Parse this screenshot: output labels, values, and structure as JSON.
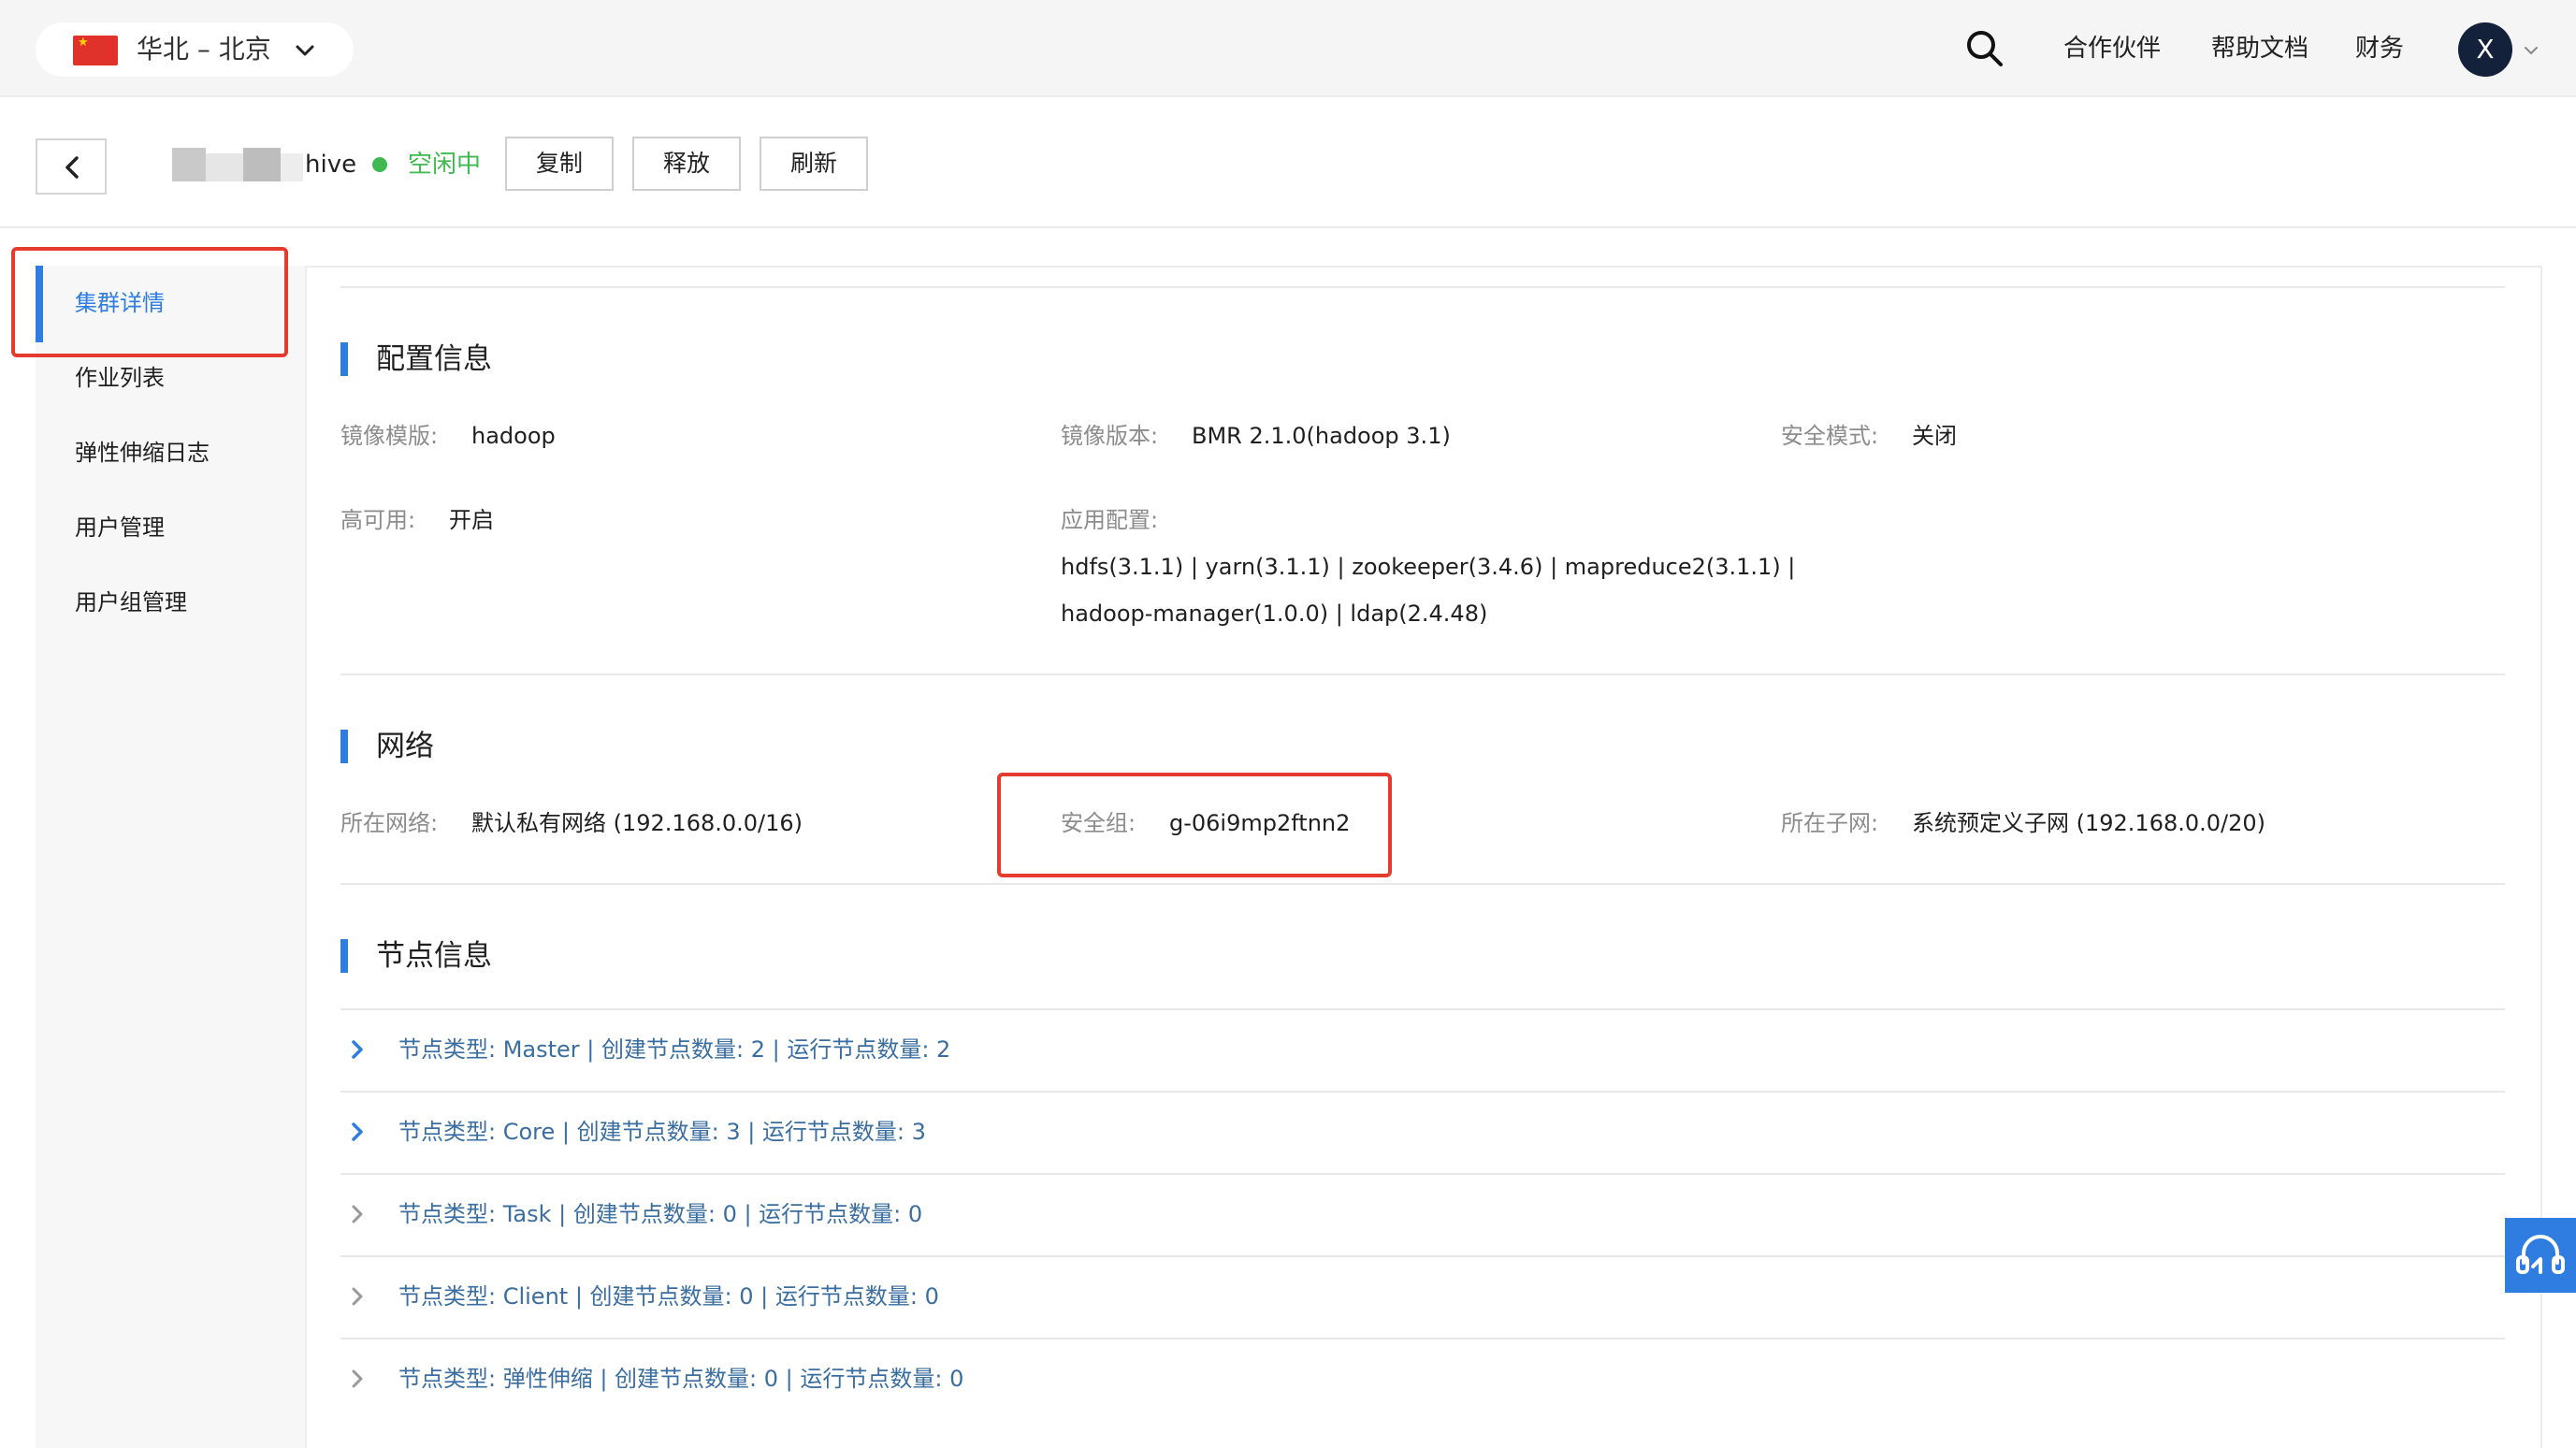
{
  "header": {
    "region_label": "华北 – 北京",
    "nav": {
      "partners": "合作伙伴",
      "docs": "帮助文档",
      "finance": "财务"
    },
    "avatar_initial": "X"
  },
  "titlebar": {
    "cluster_name": "hive",
    "status": "空闲中",
    "buttons": {
      "copy": "复制",
      "release": "释放",
      "refresh": "刷新"
    }
  },
  "sidebar": {
    "items": [
      {
        "label": "集群详情",
        "active": true
      },
      {
        "label": "作业列表"
      },
      {
        "label": "弹性伸缩日志"
      },
      {
        "label": "用户管理"
      },
      {
        "label": "用户组管理"
      }
    ]
  },
  "config": {
    "title": "配置信息",
    "image_template_label": "镜像模版:",
    "image_template_value": "hadoop",
    "image_version_label": "镜像版本:",
    "image_version_value": "BMR 2.1.0(hadoop 3.1)",
    "security_mode_label": "安全模式:",
    "security_mode_value": "关闭",
    "ha_label": "高可用:",
    "ha_value": "开启",
    "app_config_label": "应用配置:",
    "app_config_line1": "hdfs(3.1.1) | yarn(3.1.1) | zookeeper(3.4.6) | mapreduce2(3.1.1) |",
    "app_config_line2": "hadoop-manager(1.0.0) | ldap(2.4.48)"
  },
  "network": {
    "title": "网络",
    "vpc_label": "所在网络:",
    "vpc_value": "默认私有网络 (192.168.0.0/16)",
    "sg_label": "安全组:",
    "sg_value": "g-06i9mp2ftnn2",
    "subnet_label": "所在子网:",
    "subnet_value": "系统预定义子网 (192.168.0.0/20)"
  },
  "nodes": {
    "title": "节点信息",
    "rows": [
      "节点类型: Master | 创建节点数量: 2 | 运行节点数量: 2",
      "节点类型: Core | 创建节点数量: 3 | 运行节点数量: 3",
      "节点类型: Task | 创建节点数量: 0 | 运行节点数量: 0",
      "节点类型: Client | 创建节点数量: 0 | 运行节点数量: 0",
      "节点类型: 弹性伸缩 | 创建节点数量: 0 | 运行节点数量: 0"
    ]
  },
  "colors": {
    "accent": "#2f7de1",
    "status_green": "#3fb950",
    "highlight_red": "#e53a2e",
    "node_link": "#3b6ea0"
  },
  "icons": [
    "flag-cn-icon",
    "chevron-down-icon",
    "search-icon",
    "chevron-left-icon",
    "chevron-right-icon",
    "headset-icon"
  ]
}
